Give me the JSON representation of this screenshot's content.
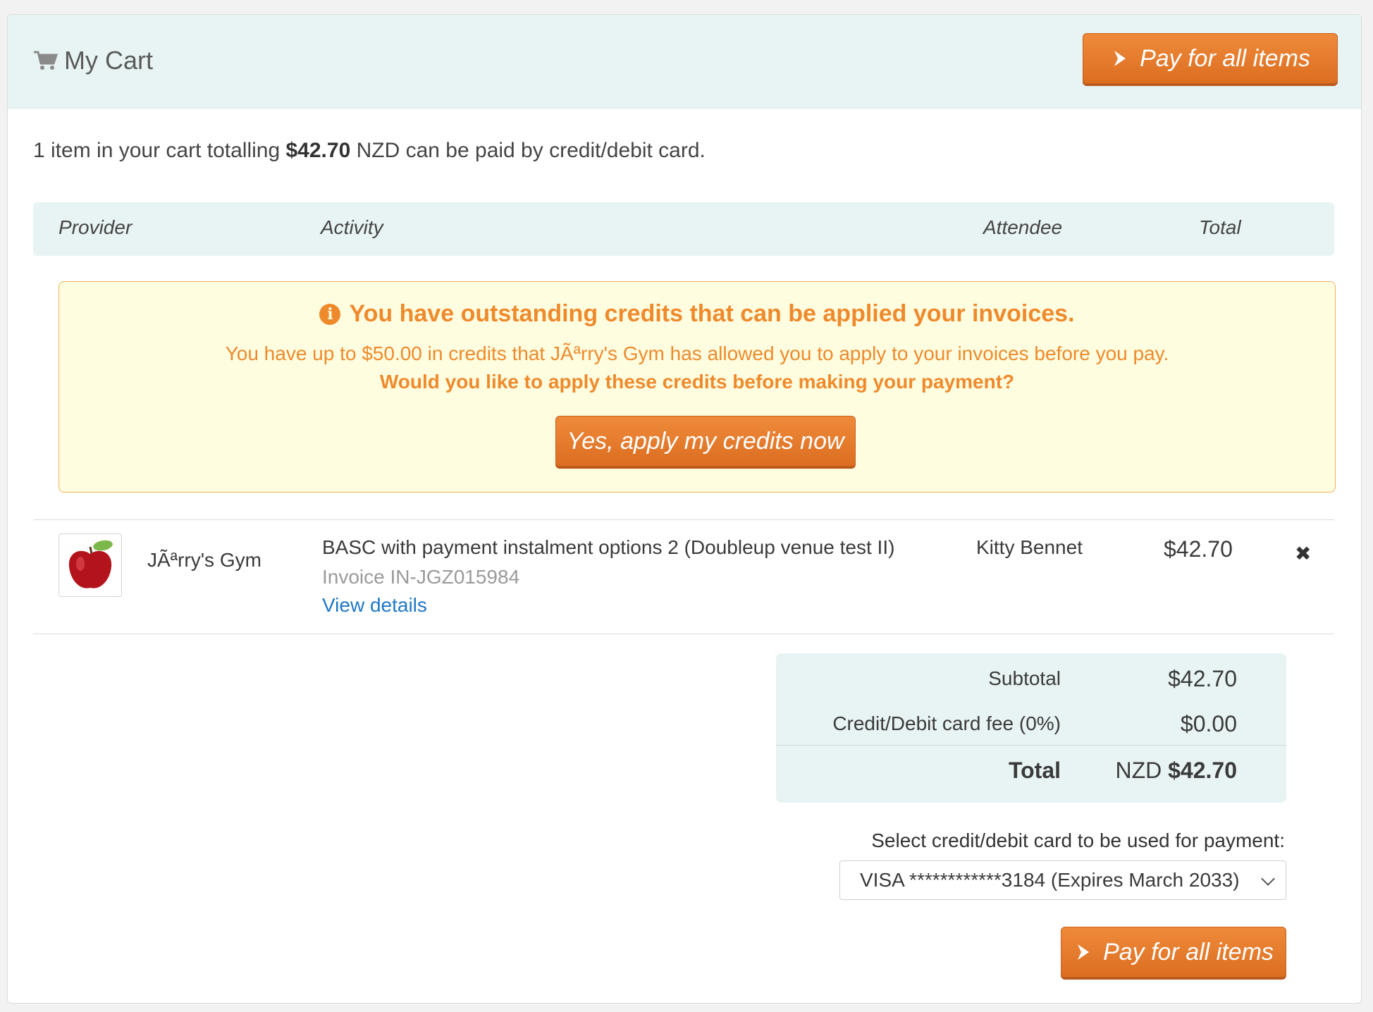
{
  "header": {
    "title": "My Cart",
    "pay_all_label": "Pay for all items"
  },
  "summary": {
    "prefix": "1 item in your cart totalling",
    "amount": "$42.70",
    "suffix": "NZD can be paid by credit/debit card."
  },
  "table": {
    "columns": [
      "Provider",
      "Activity",
      "Attendee",
      "Total"
    ]
  },
  "credits_notice": {
    "title": "You have outstanding credits that can be applied your invoices.",
    "line1": "You have up to $50.00 in credits that JÃªrry's Gym has allowed you to apply to your invoices before you pay.",
    "line2": "Would you like to apply these credits before making your payment?",
    "apply_label": "Yes, apply my credits now"
  },
  "items": [
    {
      "provider": "JÃªrry's Gym",
      "activity": "BASC with payment instalment options 2 (Doubleup venue test II)",
      "invoice": "Invoice IN-JGZ015984",
      "details_link": "View details",
      "attendee": "Kitty Bennet",
      "total": "$42.70",
      "thumbnail_icon": "apple-icon"
    }
  ],
  "totals": {
    "subtotal_label": "Subtotal",
    "subtotal_value": "$42.70",
    "fee_label": "Credit/Debit card fee (0%)",
    "fee_value": "$0.00",
    "total_label": "Total",
    "total_currency": "NZD",
    "total_value": "$42.70"
  },
  "payment": {
    "select_label": "Select credit/debit card to be used for payment:",
    "selected_card": "VISA ************3184 (Expires March 2033)",
    "pay_all_label": "Pay for all items"
  },
  "colors": {
    "accent_orange": "#e57b2c",
    "header_bg": "#e8f3f3",
    "notice_bg": "#fefde0",
    "link_blue": "#1f78c8"
  }
}
